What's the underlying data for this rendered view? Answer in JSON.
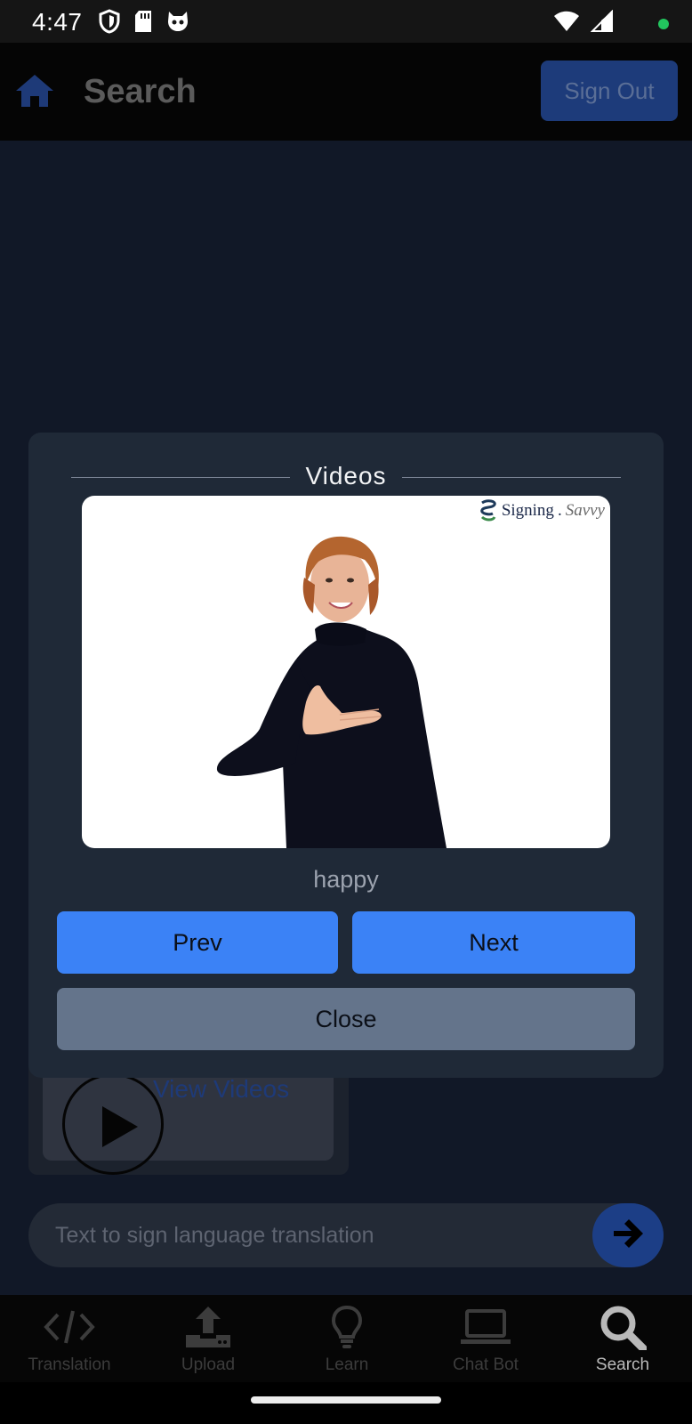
{
  "status_bar": {
    "time": "4:47",
    "icons": [
      "shield-icon",
      "sd-card-icon",
      "cat-face-icon",
      "wifi-icon",
      "cellular-signal-icon",
      "privacy-dot-icon"
    ],
    "dot_color": "#22c55e"
  },
  "header": {
    "title": "Search",
    "sign_out_label": "Sign Out"
  },
  "modal": {
    "title": "Videos",
    "video": {
      "watermark_main": "Signing",
      "watermark_script": "Savvy"
    },
    "caption": "happy",
    "prev_label": "Prev",
    "next_label": "Next",
    "close_label": "Close"
  },
  "result_card": {
    "action_label": "View Videos"
  },
  "search": {
    "placeholder": "Text to sign language translation"
  },
  "tabs": [
    {
      "label": "Translation",
      "icon": "code-icon"
    },
    {
      "label": "Upload",
      "icon": "upload-icon"
    },
    {
      "label": "Learn",
      "icon": "lightbulb-icon"
    },
    {
      "label": "Chat Bot",
      "icon": "laptop-icon"
    },
    {
      "label": "Search",
      "icon": "search-icon",
      "active": true
    }
  ],
  "colors": {
    "accent": "#3b82f6",
    "modal_bg": "#1f2937",
    "page_bg": "#111827",
    "close_button": "#64748b"
  }
}
